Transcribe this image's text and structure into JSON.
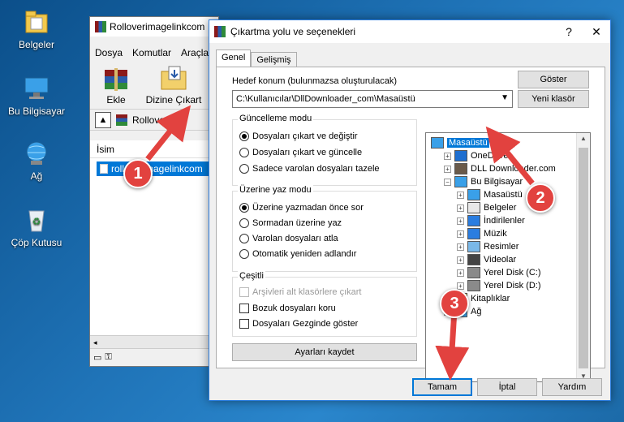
{
  "desktop": {
    "icons": [
      {
        "label": "Belgeler",
        "icon": "documents-folder-icon"
      },
      {
        "label": "Bu Bilgisayar",
        "icon": "computer-icon"
      },
      {
        "label": "Ağ",
        "icon": "network-icon"
      },
      {
        "label": "Çöp Kutusu",
        "icon": "recycle-bin-icon"
      }
    ]
  },
  "winrar": {
    "title": "Rolloverimagelinkcom",
    "menu": [
      "Dosya",
      "Komutlar",
      "Araçlar"
    ],
    "toolbar": {
      "add_label": "Ekle",
      "extract_label": "Dizine Çıkart"
    },
    "address_text": "Rolloverima",
    "column_name": "İsim",
    "file_name": "rolloverimagelinkcom"
  },
  "dialog": {
    "title": "Çıkartma yolu ve seçenekleri",
    "help_label": "?",
    "close_label": "✕",
    "tabs": [
      "Genel",
      "Gelişmiş"
    ],
    "destination_label": "Hedef konum (bulunmazsa oluşturulacak)",
    "destination_value": "C:\\Kullanıcılar\\DllDownloader_com\\Masaüstü",
    "show_button": "Göster",
    "new_folder_button": "Yeni klasör",
    "update_mode": {
      "title": "Güncelleme modu",
      "options": [
        "Dosyaları çıkart ve değiştir",
        "Dosyaları çıkart ve güncelle",
        "Sadece varolan dosyaları tazele"
      ],
      "selected": 0
    },
    "overwrite_mode": {
      "title": "Üzerine yaz modu",
      "options": [
        "Üzerine yazmadan önce sor",
        "Sormadan üzerine yaz",
        "Varolan dosyaları atla",
        "Otomatik yeniden adlandır"
      ],
      "selected": 0
    },
    "misc": {
      "title": "Çeşitli",
      "options": [
        {
          "label": "Arşivleri alt klasörlere çıkart",
          "disabled": true,
          "checked": false
        },
        {
          "label": "Bozuk dosyaları koru",
          "disabled": false,
          "checked": false
        },
        {
          "label": "Dosyaları Gezginde göster",
          "disabled": false,
          "checked": false
        }
      ]
    },
    "save_settings_button": "Ayarları kaydet",
    "tree": [
      {
        "label": "Masaüstü",
        "icon": "desktop-icon",
        "level": 0,
        "selected": true,
        "expander": ""
      },
      {
        "label": "OneDrive",
        "icon": "onedrive-icon",
        "level": 1,
        "expander": "+"
      },
      {
        "label": "DLL Downloader.com",
        "icon": "user-icon",
        "level": 1,
        "expander": "+"
      },
      {
        "label": "Bu Bilgisayar",
        "icon": "computer-icon",
        "level": 1,
        "expander": "−"
      },
      {
        "label": "Masaüstü",
        "icon": "desktop-icon",
        "level": 2,
        "expander": "+"
      },
      {
        "label": "Belgeler",
        "icon": "documents-icon",
        "level": 2,
        "expander": "+"
      },
      {
        "label": "İndirilenler",
        "icon": "downloads-icon",
        "level": 2,
        "expander": "+"
      },
      {
        "label": "Müzik",
        "icon": "music-icon",
        "level": 2,
        "expander": "+"
      },
      {
        "label": "Resimler",
        "icon": "pictures-icon",
        "level": 2,
        "expander": "+"
      },
      {
        "label": "Videolar",
        "icon": "videos-icon",
        "level": 2,
        "expander": "+"
      },
      {
        "label": "Yerel Disk (C:)",
        "icon": "drive-icon",
        "level": 2,
        "expander": "+"
      },
      {
        "label": "Yerel Disk (D:)",
        "icon": "drive-icon",
        "level": 2,
        "expander": "+"
      },
      {
        "label": "Kitaplıklar",
        "icon": "libraries-icon",
        "level": 1,
        "expander": "+"
      },
      {
        "label": "Ağ",
        "icon": "network-icon",
        "level": 1,
        "expander": "+"
      }
    ],
    "ok_button": "Tamam",
    "cancel_button": "İptal",
    "help_button": "Yardım"
  },
  "annotations": {
    "markers": [
      "1",
      "2",
      "3"
    ],
    "color": "#e2423f"
  },
  "colors": {
    "selection": "#0078d7",
    "accent_border": "#2b7de0"
  }
}
